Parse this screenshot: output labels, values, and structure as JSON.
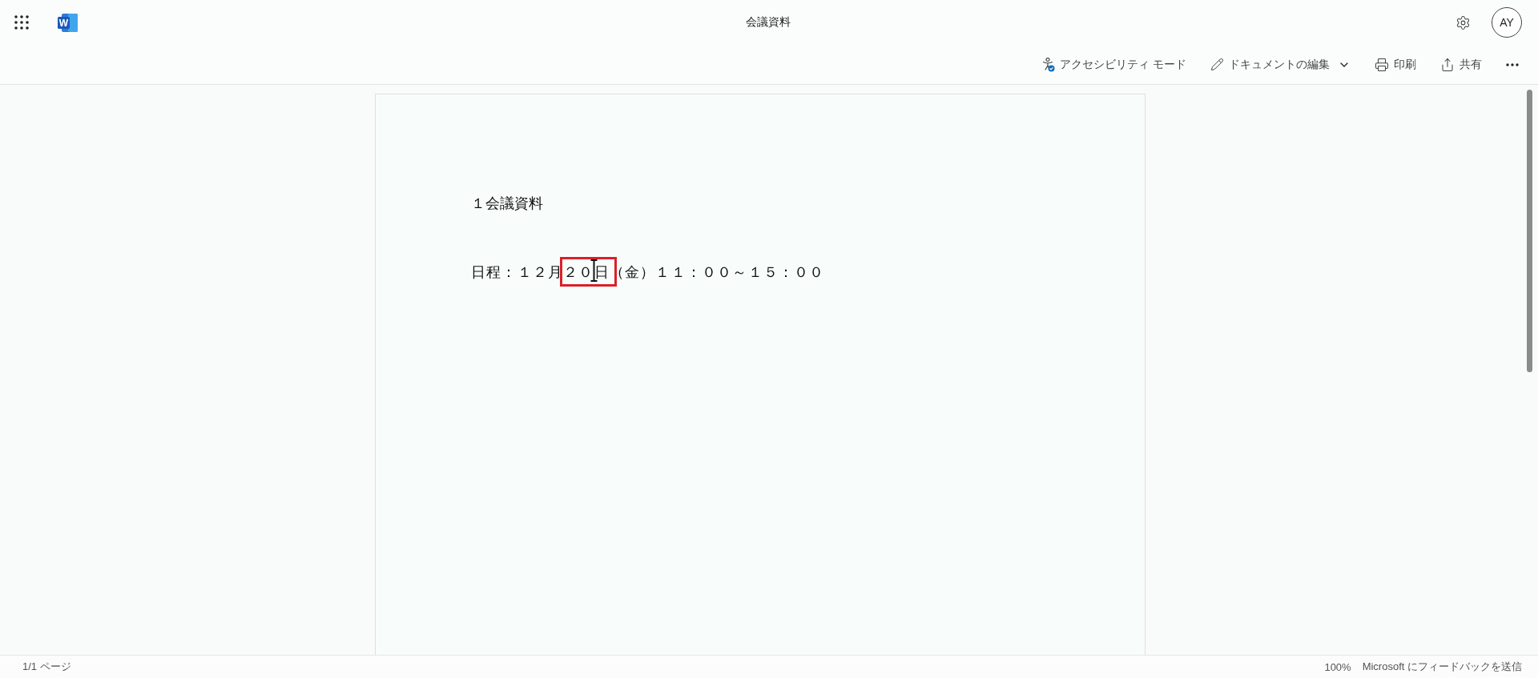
{
  "app_bar": {
    "logo_letter": "W",
    "title": "会議資料",
    "avatar": "AY"
  },
  "toolbar": [
    {
      "kind": "accessibility",
      "label": "アクセシビリティ モード"
    },
    {
      "kind": "edit",
      "label": "ドキュメントの編集"
    },
    {
      "kind": "print",
      "label": "印刷"
    },
    {
      "kind": "share",
      "label": "共有"
    },
    {
      "kind": "more"
    }
  ],
  "document": {
    "paragraphs": [
      {
        "runs": [
          {
            "text": "１会議資料",
            "highlighted": false
          }
        ]
      },
      {
        "runs": [
          {
            "text": "日程：１２月",
            "highlighted": false
          },
          {
            "text": "２０日",
            "highlighted": true
          },
          {
            "text": "（金）１１：００～１５：００",
            "highlighted": false
          }
        ]
      }
    ]
  },
  "status_bar": {
    "page_indicator": "1/1 ページ",
    "zoom": "100%",
    "feedback_link": "Microsoft にフィードバックを送信"
  }
}
